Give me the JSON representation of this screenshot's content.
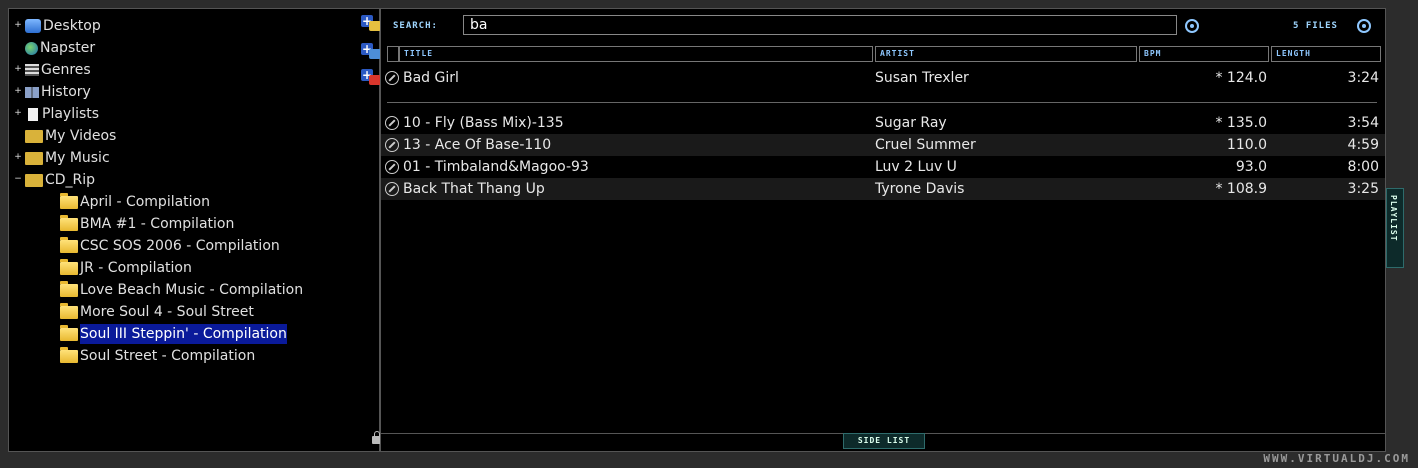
{
  "tree": {
    "items": [
      {
        "label": "Desktop",
        "expander": "+",
        "icon": "desktop-icon"
      },
      {
        "label": "Napster",
        "expander": "",
        "icon": "globe-icon"
      },
      {
        "label": "Genres",
        "expander": "+",
        "icon": "genres-icon"
      },
      {
        "label": "History",
        "expander": "+",
        "icon": "history-icon"
      },
      {
        "label": "Playlists",
        "expander": "+",
        "icon": "playlist-icon"
      },
      {
        "label": "My Videos",
        "expander": "",
        "icon": "video-folder-icon"
      },
      {
        "label": "My Music",
        "expander": "+",
        "icon": "music-folder-icon"
      },
      {
        "label": "CD_Rip",
        "expander": "−",
        "icon": "cd-folder-icon"
      }
    ],
    "subitems": [
      "April - Compilation",
      "BMA #1 - Compilation",
      "CSC SOS 2006 - Compilation",
      "JR - Compilation",
      "Love Beach Music - Compilation",
      "More Soul 4 - Soul Street",
      "Soul III Steppin' - Compilation",
      "Soul Street - Compilation"
    ],
    "selected": "Soul III Steppin' - Compilation"
  },
  "search": {
    "label": "SEARCH:",
    "value": "ba",
    "file_count": "5 FILES"
  },
  "columns": {
    "title": "TITLE",
    "artist": "ARTIST",
    "bpm": "BPM",
    "length": "LENGTH"
  },
  "rows": [
    {
      "title": "Bad Girl",
      "artist": "Susan Trexler",
      "bpm": "* 124.0",
      "length": "3:24"
    },
    {
      "title": "10 - Fly (Bass Mix)-135",
      "artist": "Sugar Ray",
      "bpm": "* 135.0",
      "length": "3:54"
    },
    {
      "title": "13 - Ace Of Base-110",
      "artist": "Cruel Summer",
      "bpm": "110.0",
      "length": "4:59"
    },
    {
      "title": "01 - Timbaland&Magoo-93",
      "artist": "Luv 2 Luv U",
      "bpm": "93.0",
      "length": "8:00"
    },
    {
      "title": "Back That Thang Up",
      "artist": "Tyrone Davis",
      "bpm": "* 108.9",
      "length": "3:25"
    }
  ],
  "tabs": {
    "side_list": "SIDE LIST",
    "playlist": "PLAYLIST"
  },
  "watermark": "WWW.VIRTUALDJ.COM",
  "colors": {
    "accent": "#8fc8ff",
    "selection": "#0a1a9a",
    "background": "#000000"
  }
}
